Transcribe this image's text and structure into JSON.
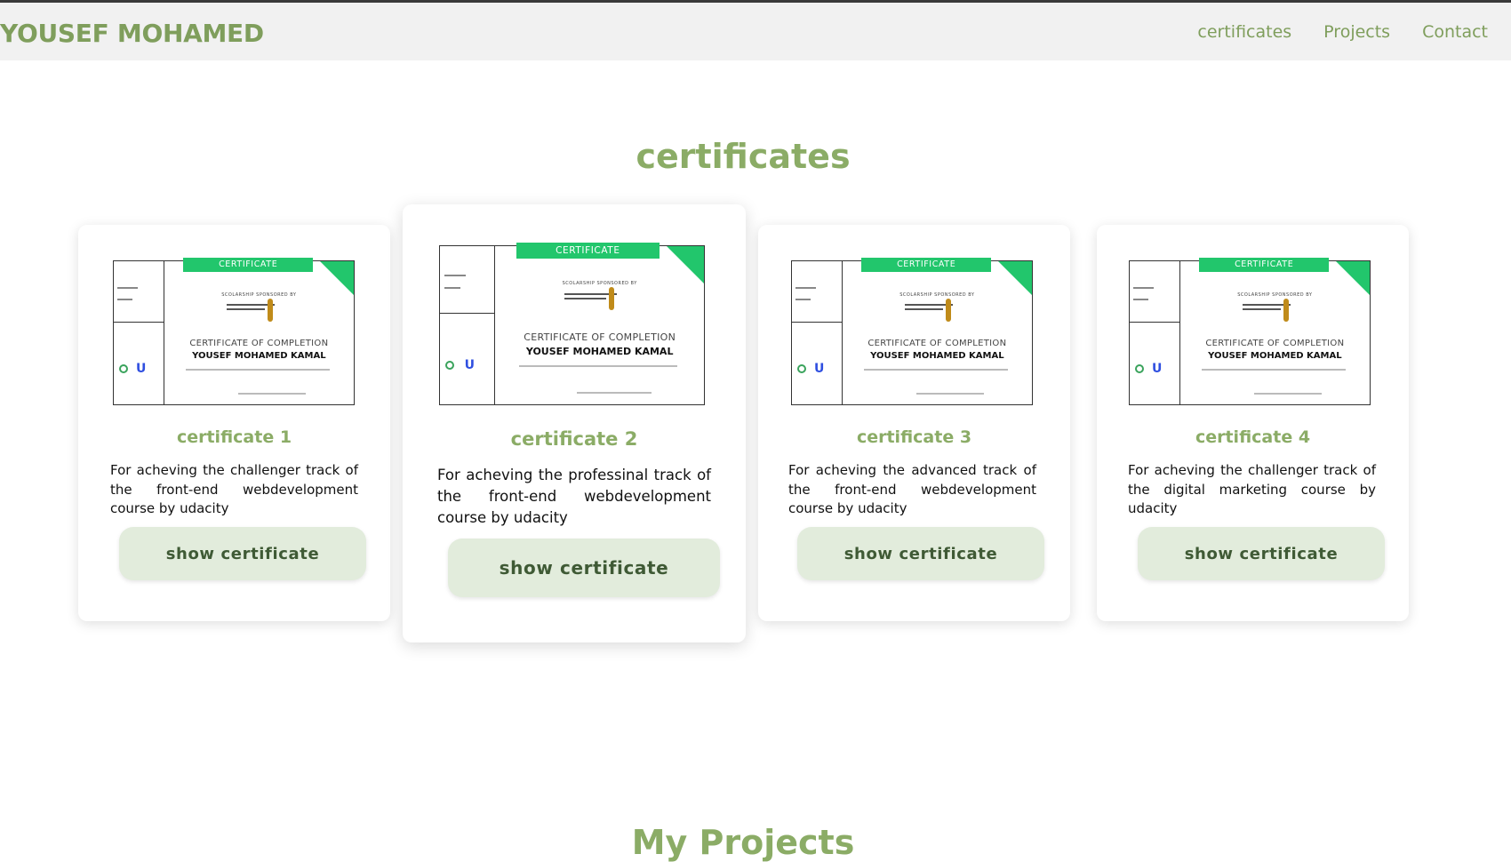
{
  "header": {
    "brand": "YOUSEF MOHAMED",
    "nav": [
      {
        "label": "certificates"
      },
      {
        "label": "Projects"
      },
      {
        "label": "Contact"
      }
    ]
  },
  "sections": {
    "certificates_title": "certificates",
    "projects_title": "My Projects"
  },
  "certificate_image": {
    "ribbon": "CERTIFICATE",
    "sponsor": "SCOLARSHIP SPONSORED BY",
    "completion": "CERTIFICATE OF COMPLETION",
    "name": "YOUSEF MOHAMED KAMAL",
    "brand_color": "#22c66c"
  },
  "cards": [
    {
      "title": "certificate 1",
      "description": "For acheving the challenger track of the front-end webdevelopment course by udacity",
      "button": "show certificate"
    },
    {
      "title": "certificate 2",
      "description": "For acheving the professinal track of the front-end webdevelopment course by udacity",
      "button": "show certificate"
    },
    {
      "title": "certificate 3",
      "description": "For acheving the advanced track of the front-end webdevelopment course by udacity",
      "button": "show certificate"
    },
    {
      "title": "certificate 4",
      "description": "For acheving the challenger track of the digital marketing course by udacity",
      "button": "show certificate"
    }
  ],
  "theme": {
    "accent": "#8bac66",
    "nav_background": "#f1f1f1",
    "button_background": "#e2ecdc"
  }
}
